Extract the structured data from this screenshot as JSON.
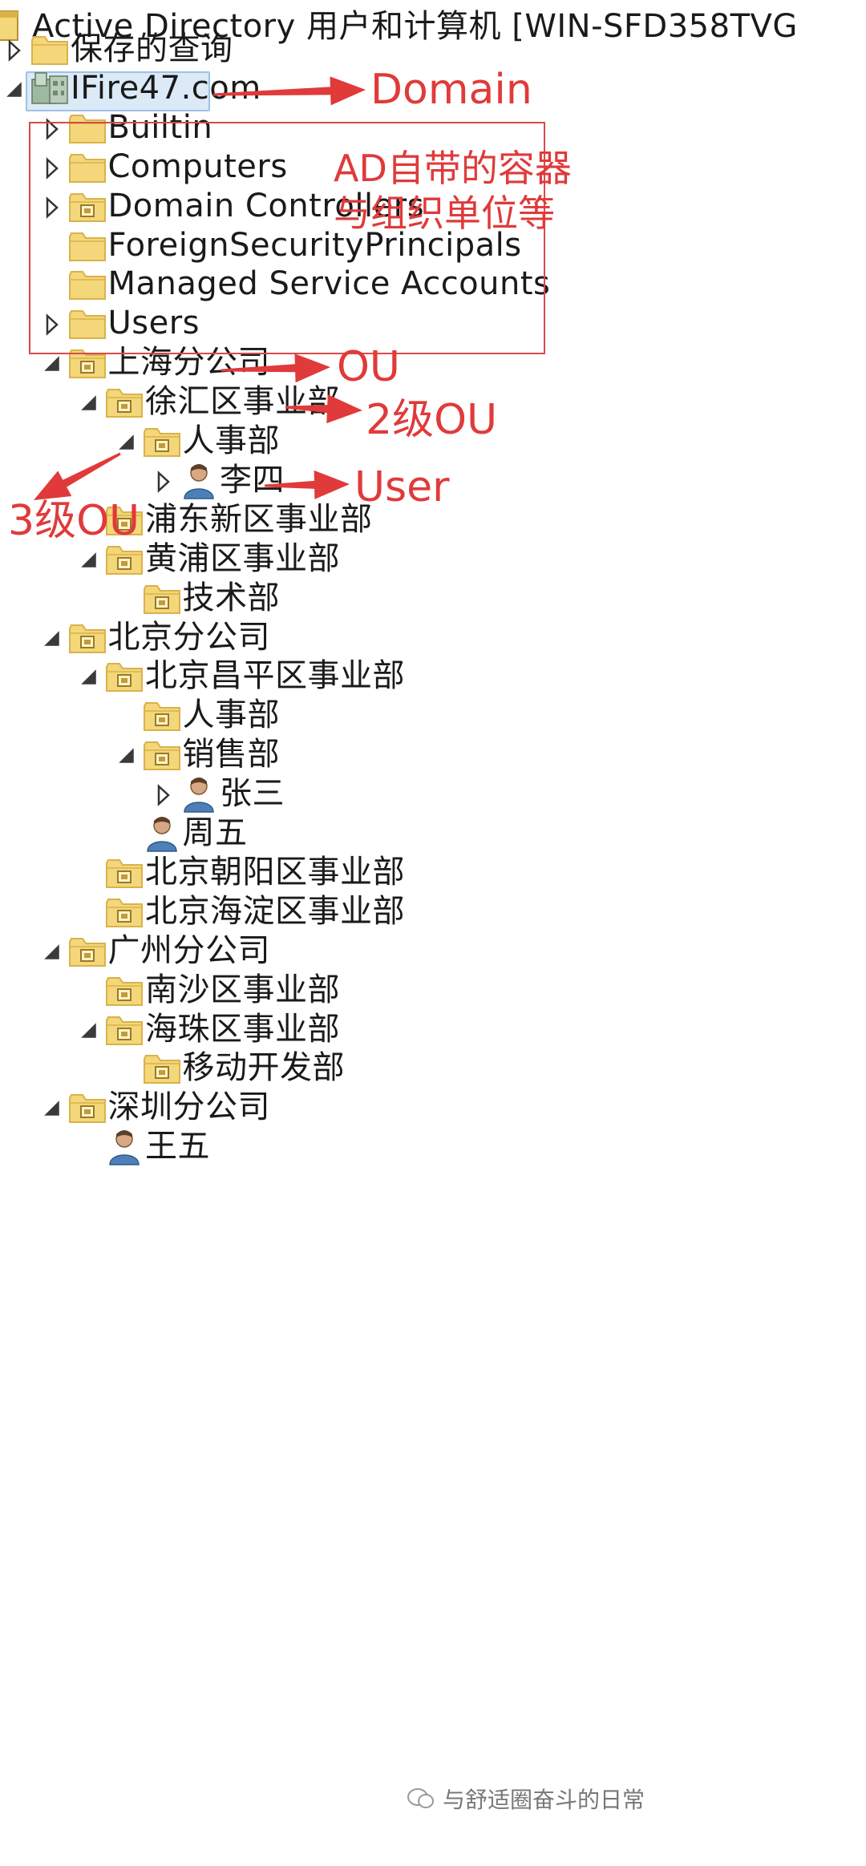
{
  "window": {
    "title": "Active Directory 用户和计算机 [WIN-SFD358TVG"
  },
  "tree": [
    {
      "id": "saved",
      "label": "保存的查询",
      "icon": "folder",
      "toggle": "collapsed",
      "depth": 0
    },
    {
      "id": "domain",
      "label": "IFire47.com",
      "icon": "domain",
      "toggle": "expanded",
      "depth": 0,
      "selected": true
    },
    {
      "id": "builtin",
      "label": "Builtin",
      "icon": "folder",
      "toggle": "collapsed",
      "depth": 1
    },
    {
      "id": "computers",
      "label": "Computers",
      "icon": "folder",
      "toggle": "collapsed",
      "depth": 1
    },
    {
      "id": "dc",
      "label": "Domain Controllers",
      "icon": "ou",
      "toggle": "collapsed",
      "depth": 1
    },
    {
      "id": "fsp",
      "label": "ForeignSecurityPrincipals",
      "icon": "folder",
      "toggle": "none",
      "depth": 1
    },
    {
      "id": "msa",
      "label": "Managed Service Accounts",
      "icon": "folder",
      "toggle": "none",
      "depth": 1
    },
    {
      "id": "users",
      "label": "Users",
      "icon": "folder",
      "toggle": "collapsed",
      "depth": 1
    },
    {
      "id": "sh",
      "label": "上海分公司",
      "icon": "ou",
      "toggle": "expanded",
      "depth": 1
    },
    {
      "id": "sh-xh",
      "label": "徐汇区事业部",
      "icon": "ou",
      "toggle": "expanded",
      "depth": 2
    },
    {
      "id": "sh-xh-hr",
      "label": "人事部",
      "icon": "ou",
      "toggle": "expanded",
      "depth": 3
    },
    {
      "id": "sh-xh-hr-ls",
      "label": "李四",
      "icon": "user",
      "toggle": "collapsed",
      "depth": 4
    },
    {
      "id": "sh-pd",
      "label": "浦东新区事业部",
      "icon": "ou",
      "toggle": "none",
      "depth": 2
    },
    {
      "id": "sh-hp",
      "label": "黄浦区事业部",
      "icon": "ou",
      "toggle": "expanded",
      "depth": 2
    },
    {
      "id": "sh-hp-tech",
      "label": "技术部",
      "icon": "ou",
      "toggle": "none",
      "depth": 3
    },
    {
      "id": "bj",
      "label": "北京分公司",
      "icon": "ou",
      "toggle": "expanded",
      "depth": 1
    },
    {
      "id": "bj-cp",
      "label": "北京昌平区事业部",
      "icon": "ou",
      "toggle": "expanded",
      "depth": 2
    },
    {
      "id": "bj-cp-hr",
      "label": "人事部",
      "icon": "ou",
      "toggle": "none",
      "depth": 3
    },
    {
      "id": "bj-cp-sales",
      "label": "销售部",
      "icon": "ou",
      "toggle": "expanded",
      "depth": 3
    },
    {
      "id": "bj-cp-sales-zs",
      "label": "张三",
      "icon": "user",
      "toggle": "collapsed",
      "depth": 4
    },
    {
      "id": "bj-cp-zw",
      "label": "周五",
      "icon": "user",
      "toggle": "none",
      "depth": 3
    },
    {
      "id": "bj-cy",
      "label": "北京朝阳区事业部",
      "icon": "ou",
      "toggle": "none",
      "depth": 2
    },
    {
      "id": "bj-hd",
      "label": "北京海淀区事业部",
      "icon": "ou",
      "toggle": "none",
      "depth": 2
    },
    {
      "id": "gz",
      "label": "广州分公司",
      "icon": "ou",
      "toggle": "expanded",
      "depth": 1
    },
    {
      "id": "gz-ns",
      "label": "南沙区事业部",
      "icon": "ou",
      "toggle": "none",
      "depth": 2
    },
    {
      "id": "gz-hz",
      "label": "海珠区事业部",
      "icon": "ou",
      "toggle": "expanded",
      "depth": 2
    },
    {
      "id": "gz-hz-mob",
      "label": "移动开发部",
      "icon": "ou",
      "toggle": "none",
      "depth": 3
    },
    {
      "id": "sz",
      "label": "深圳分公司",
      "icon": "ou",
      "toggle": "expanded",
      "depth": 1
    },
    {
      "id": "sz-ww",
      "label": "王五",
      "icon": "user",
      "toggle": "none",
      "depth": 2
    }
  ],
  "annotations": {
    "domain": "Domain",
    "builtin_box": "AD自带的容器与组织单位等",
    "ou": "OU",
    "ou2": "2级OU",
    "ou3": "3级OU",
    "user": "User",
    "color": "#e03a3a"
  },
  "watermark": {
    "text": "与舒适圈奋斗的日常"
  },
  "colors": {
    "folder": "#f4d77a",
    "folder_dark": "#d9b24a",
    "selection": "#dce9f7",
    "annotation": "#e03a3a"
  }
}
